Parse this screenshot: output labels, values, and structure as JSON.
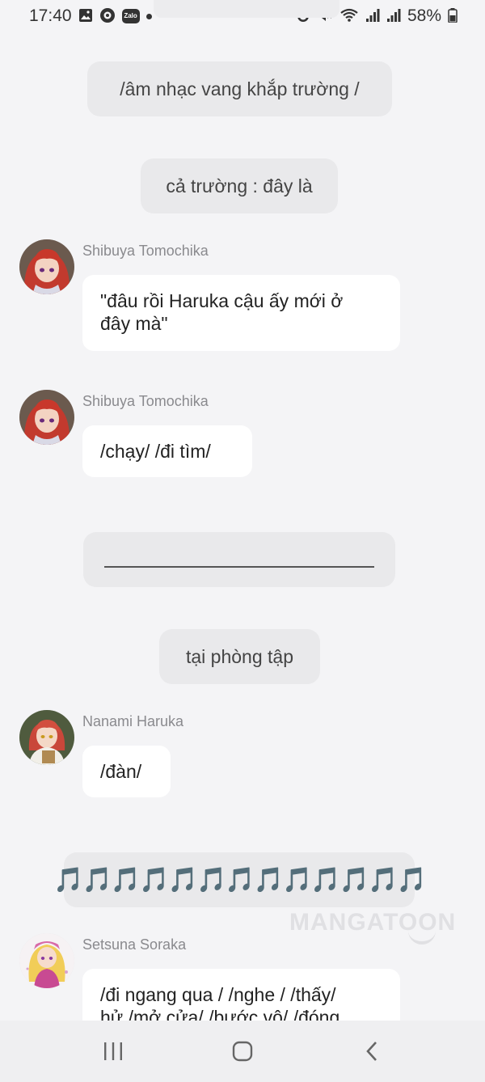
{
  "status_bar": {
    "time": "17:40",
    "left_icons": [
      "image-icon",
      "messenger-icon",
      "zalo-icon",
      "notification-dot-icon"
    ],
    "zalo_label": "Zalo",
    "right_icons": [
      "alarm-icon",
      "mute-icon",
      "wifi-icon",
      "signal-icon",
      "signal-icon"
    ],
    "battery": "58%"
  },
  "chat": {
    "narration_1": "/âm nhạc vang khắp trường /",
    "narration_2": "cả trường : đây là",
    "msg_1": {
      "sender": "Shibuya Tomochika",
      "text_line1": "\"đâu rồi Haruka cậu ấy mới ở",
      "text_line2": "đây mà\""
    },
    "msg_2": {
      "sender": "Shibuya Tomochika",
      "text": "/chạy/ /đi tìm/"
    },
    "narration_4": "tại phòng tập",
    "msg_3": {
      "sender": "Nanami Haruka",
      "text": "/đàn/"
    },
    "narration_5": "🎵🎵🎵🎵🎵🎵🎵🎵🎵🎵🎵🎵🎵",
    "msg_4": {
      "sender": "Setsuna Soraka",
      "text_line1": "/đi ngang qua / /nghe / /thấy/",
      "text_line2": "hử /mở cửa/ /bước vô/ /đóng"
    }
  },
  "watermark": "MANGATOON",
  "colors": {
    "background": "#f4f4f6",
    "narration_bg": "#e9e9eb",
    "bubble_bg": "#ffffff",
    "sender_text": "#8a8a8e",
    "note_color": "#7b2fd0"
  },
  "nav_bar": {
    "icons": [
      "recents-icon",
      "home-icon",
      "back-icon"
    ]
  }
}
